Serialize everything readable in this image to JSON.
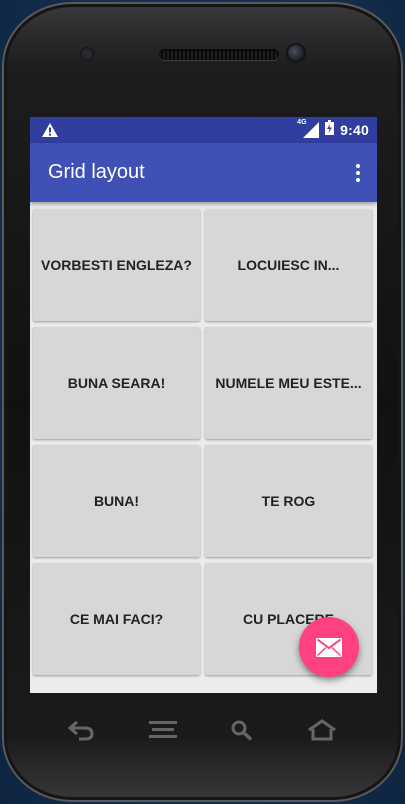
{
  "status_bar": {
    "time": "9:40",
    "network": "4G",
    "icons": [
      "warning-icon",
      "signal-icon",
      "battery-charging-icon"
    ]
  },
  "toolbar": {
    "title": "Grid layout",
    "menu_icon": "more-vert-icon"
  },
  "grid": {
    "cells": [
      {
        "label": "VORBESTI ENGLEZA?"
      },
      {
        "label": "LOCUIESC IN..."
      },
      {
        "label": "BUNA SEARA!"
      },
      {
        "label": "NUMELE MEU ESTE..."
      },
      {
        "label": "BUNA!"
      },
      {
        "label": "TE ROG"
      },
      {
        "label": "CE MAI FACI?"
      },
      {
        "label": "CU PLACERE"
      }
    ]
  },
  "fab": {
    "icon": "email-icon"
  },
  "nav_bar": {
    "icons": [
      "back-icon",
      "menu-icon",
      "search-icon",
      "home-icon"
    ]
  },
  "colors": {
    "primary": "#3f51b5",
    "primary_dark": "#303f9f",
    "accent": "#ff4081",
    "cell_background": "#d7d7d7"
  }
}
